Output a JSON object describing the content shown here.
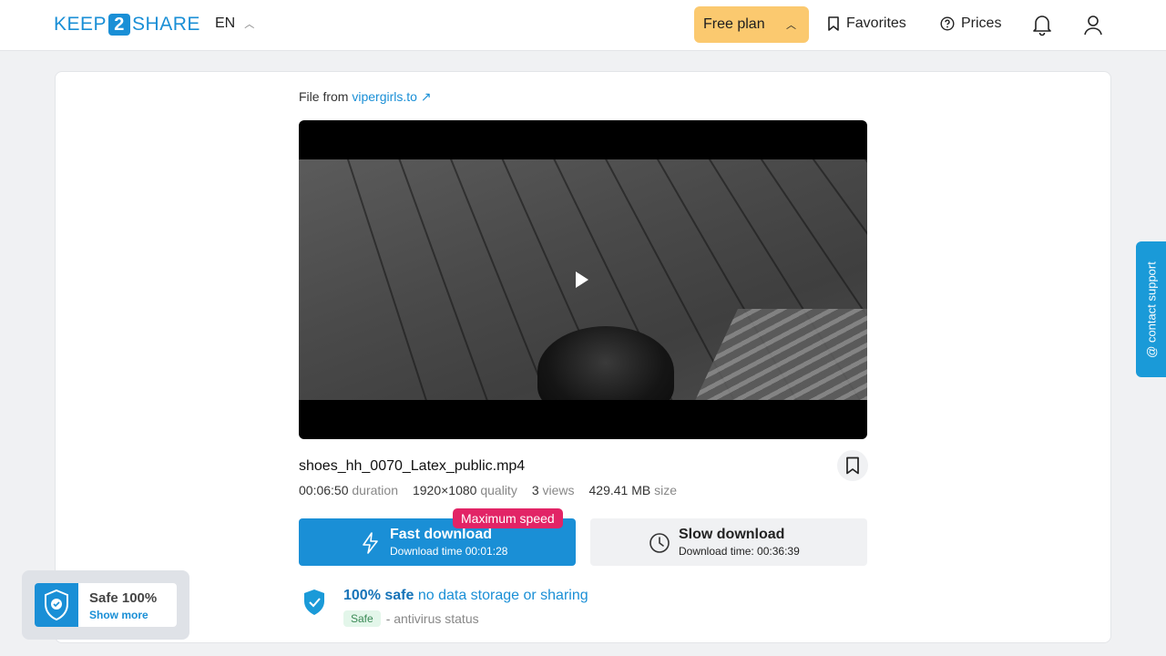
{
  "header": {
    "logo": {
      "left": "KEEP",
      "mid": "2",
      "right": "SHARE"
    },
    "language": "EN",
    "plan_label": "Free plan",
    "favorites_label": "Favorites",
    "prices_label": "Prices"
  },
  "file": {
    "from_label": "File from",
    "from_site": "vipergirls.to",
    "name": "shoes_hh_0070_Latex_public.mp4",
    "meta": [
      {
        "value": "00:06:50",
        "unit": "duration"
      },
      {
        "value": "1920×1080",
        "unit": "quality"
      },
      {
        "value": "3",
        "unit": "views"
      },
      {
        "value": "429.41 MB",
        "unit": "size"
      }
    ]
  },
  "downloads": {
    "fast": {
      "title": "Fast download",
      "subtitle": "Download time 00:01:28",
      "badge": "Maximum speed"
    },
    "slow": {
      "title": "Slow download",
      "subtitle": "Download time: 00:36:39"
    }
  },
  "safety": {
    "headline_bold": "100% safe",
    "headline_rest": " no data storage or sharing",
    "tag": "Safe",
    "status": "- antivirus status"
  },
  "float_badge": {
    "title": "Safe 100%",
    "link": "Show more"
  },
  "support_tab": "@ contact support",
  "colors": {
    "accent": "#1a8fd6",
    "plan": "#fbc96f",
    "badge": "#e22466"
  },
  "icons": [
    "bookmark-icon",
    "help-circle-icon",
    "bell-icon",
    "user-icon",
    "lightning-icon",
    "clock-icon",
    "shield-check-icon",
    "play-icon",
    "external-link-icon"
  ]
}
